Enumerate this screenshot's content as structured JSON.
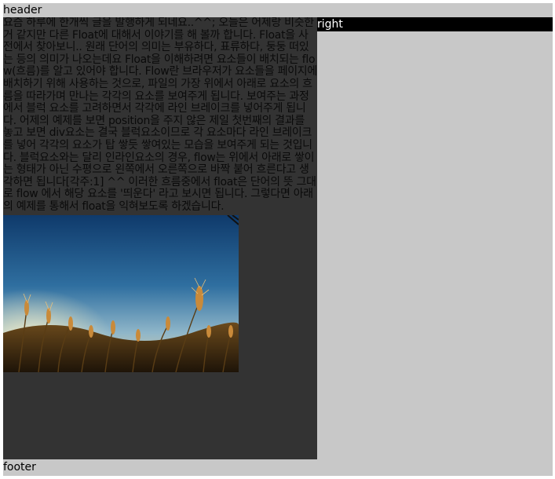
{
  "header": {
    "label": "header"
  },
  "right": {
    "label": "right"
  },
  "footer": {
    "label": "footer"
  },
  "content": {
    "article": "요즘 하루에 한개씩 글을 발행하게 되네요..^^; 오늘은 어제랑 비슷한거 같지만 다른 Float에 대해서 이야기를 해 볼까 합니다. Float을 사전에서 찾아보니.. 원래 단어의 의미는 부유하다, 표류하다, 둥둥 떠있는 등의 의미가 나오는데요 Float을 이해하려면 요소들이 배치되는 flow(흐름)를 알고 있어야 합니다. Flow란 브라우저가 요소들을 페이지에 배치하기 위해 사용하는 것으로, 파일의 가장 위에서 아래로 요소의 흐름을 따라가며 만나는 각각의 요소를 보여주게 됩니다. 보여주는 과정에서 블럭 요소를 고려하면서 각각에 라인 브레이크를 넣어주게 됩니다. 어제의 예제를 보면 position을 주지 않은 제일 첫번째의 결과를 놓고 보면 div요소는 결국 블럭요소이므로 각 요소마다 라인 브레이크를 넣어 각각의 요소가 탑 쌓듯 쌓여있는 모습을 보여주게 되는 것입니다. 블럭요소와는 달리 인라인요소의 경우, flow는 위에서 아래로 쌓이는 형태가 아닌 수평으로 왼쪽에서 오른쪽으로 바짝 붙어 흐른다고 생각하면 됩니다[각주:1] ^^ 이러한 흐름중에서 float은 단어의 뜻 그대로 flow 에서 해당 요소를 '띄운다' 라고 보시면 됩니다. 그렇다면 아래의 예제를 통해서 float을 익혀보도록 하겠습니다."
  },
  "colors": {
    "page_background": "#c8c8c8",
    "left_column": "#333333",
    "right_bar": "#000000",
    "right_text": "#ffffff",
    "body_text": "#0a0a0a"
  },
  "image": {
    "subject": "wheat-field-photo"
  }
}
